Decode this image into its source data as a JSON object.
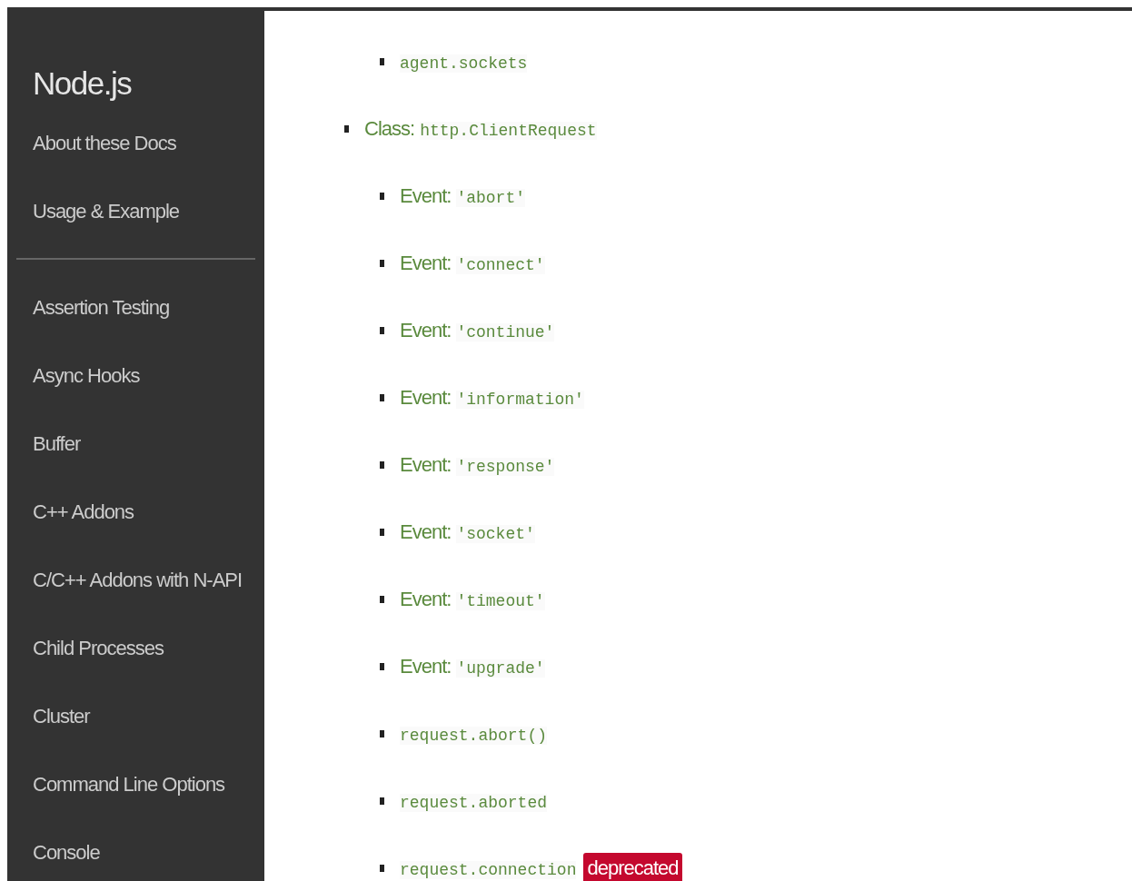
{
  "sidebar": {
    "title": "Node.js",
    "groups": [
      [
        "About these Docs",
        "Usage & Example"
      ],
      [
        "Assertion Testing",
        "Async Hooks",
        "Buffer",
        "C++ Addons",
        "C/C++ Addons with N-API",
        "Child Processes",
        "Cluster",
        "Command Line Options",
        "Console"
      ]
    ]
  },
  "toc": [
    {
      "children": [
        {
          "code": "agent.sockets"
        }
      ]
    },
    {
      "prefix": "Class:",
      "code": "http.ClientRequest",
      "children": [
        {
          "prefix": "Event:",
          "code": "'abort'"
        },
        {
          "prefix": "Event:",
          "code": "'connect'"
        },
        {
          "prefix": "Event:",
          "code": "'continue'"
        },
        {
          "prefix": "Event:",
          "code": "'information'"
        },
        {
          "prefix": "Event:",
          "code": "'response'"
        },
        {
          "prefix": "Event:",
          "code": "'socket'"
        },
        {
          "prefix": "Event:",
          "code": "'timeout'"
        },
        {
          "prefix": "Event:",
          "code": "'upgrade'"
        },
        {
          "code": "request.abort()"
        },
        {
          "code": "request.aborted"
        },
        {
          "code": "request.connection",
          "badge": "deprecated"
        }
      ]
    }
  ]
}
